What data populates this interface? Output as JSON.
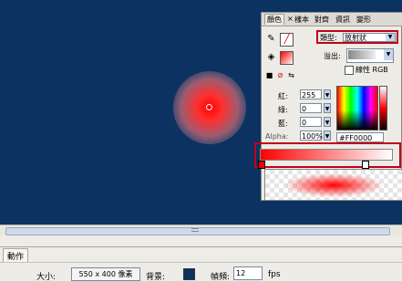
{
  "panel": {
    "tabs": [
      "顏色",
      "×",
      "樣本",
      "對齊",
      "資訊",
      "變形"
    ],
    "type_label": "類型:",
    "type_value": "放射狀",
    "spread_label": "溢出:",
    "linear_rgb_label": "線性 RGB",
    "red_label": "紅:",
    "red_value": "255",
    "green_label": "綠:",
    "green_value": "0",
    "blue_label": "藍:",
    "blue_value": "0",
    "alpha_label": "Alpha:",
    "alpha_value": "100%",
    "hex_value": "#FF0000"
  },
  "timeline_tab": "動作",
  "properties": {
    "size_label": "大小:",
    "size_value": "550 x 400 像素",
    "bg_label": "背景:",
    "fps_label": "幀頻:",
    "fps_value": "12",
    "fps_unit": "fps"
  },
  "colors": {
    "stage": "#0c3262",
    "highlight": "#c00018",
    "fill": "#FF0000"
  }
}
